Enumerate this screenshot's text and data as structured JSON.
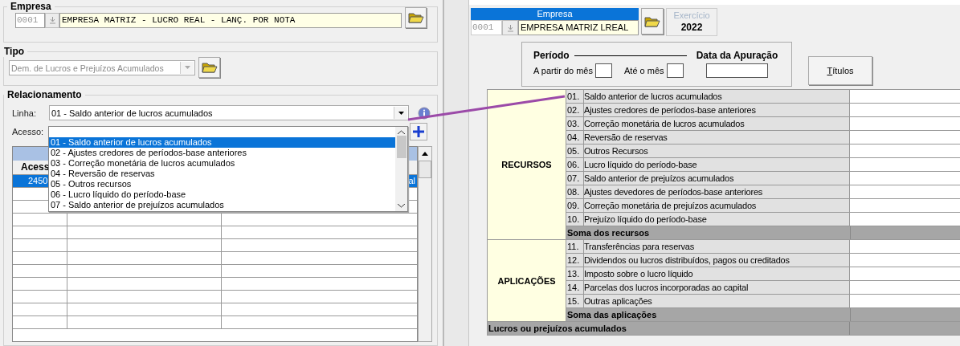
{
  "left": {
    "empresa": {
      "legend": "Empresa",
      "code": "0001",
      "name": "EMPRESA  MATRIZ - LUCRO REAL - LANÇ. POR NOTA"
    },
    "tipo": {
      "legend": "Tipo",
      "value": "Dem. de Lucros e Prejuízos Acumulados"
    },
    "relacionamento": {
      "legend": "Relacionamento",
      "linha_label": "Linha:",
      "linha_value": "01 - Saldo anterior de lucros acumulados",
      "acesso_label": "Acesso:",
      "dropdown_items": [
        {
          "label": "01 - Saldo anterior de lucros acumulados",
          "selected": true
        },
        {
          "label": "02 - Ajustes credores de períodos-base anteriores",
          "selected": false
        },
        {
          "label": "03 - Correção monetária de lucros acumulados",
          "selected": false
        },
        {
          "label": "04 - Reversão de reservas",
          "selected": false
        },
        {
          "label": "05 - Outros recursos",
          "selected": false
        },
        {
          "label": "06 - Lucro líquido do período-base",
          "selected": false
        },
        {
          "label": "07 - Saldo anterior de prejuízos acumulados",
          "selected": false
        }
      ],
      "grid": {
        "header": "Acess",
        "rows": [
          {
            "selected": true,
            "cells": [
              "2450",
              "al"
            ]
          }
        ]
      }
    }
  },
  "right": {
    "empresa": {
      "title": "Empresa",
      "code": "0001",
      "name": "EMPRESA MATRIZ LREAL"
    },
    "exercicio": {
      "label": "Exercício",
      "year": "2022"
    },
    "periodo": {
      "title": "Período",
      "from_label": "A partir do mês",
      "to_label": "Até o mês",
      "data_label": "Data da Apuração"
    },
    "titulos_button": "Títulos",
    "table": {
      "groups": [
        {
          "label": "RECURSOS",
          "rows": [
            {
              "number": "01.",
              "label": "Saldo anterior de lucros acumulados"
            },
            {
              "number": "02.",
              "label": "Ajustes credores de períodos-base anteriores"
            },
            {
              "number": "03.",
              "label": "Correção monetária de lucros acumulados"
            },
            {
              "number": "04.",
              "label": "Reversão de reservas"
            },
            {
              "number": "05.",
              "label": "Outros Recursos"
            },
            {
              "number": "06.",
              "label": "Lucro líquido do período-base"
            },
            {
              "number": "07.",
              "label": "Saldo anterior de prejuízos acumulados"
            },
            {
              "number": "08.",
              "label": "Ajustes devedores de períodos-base anteriores"
            },
            {
              "number": "09.",
              "label": "Correção monetária de prejuízos acumulados"
            },
            {
              "number": "10.",
              "label": "Prejuízo líquido do período-base"
            }
          ],
          "total": "Soma dos recursos"
        },
        {
          "label": "APLICAÇÕES",
          "rows": [
            {
              "number": "11.",
              "label": "Transferências para reservas"
            },
            {
              "number": "12.",
              "label": "Dividendos ou lucros distribuídos, pagos ou creditados"
            },
            {
              "number": "13.",
              "label": "Imposto sobre o lucro líquido"
            },
            {
              "number": "14.",
              "label": "Parcelas dos lucros incorporadas ao capital"
            },
            {
              "number": "15.",
              "label": "Outras aplicações"
            }
          ],
          "total": "Soma das aplicações"
        }
      ],
      "final_total": "Lucros ou prejuízos acumulados"
    }
  }
}
